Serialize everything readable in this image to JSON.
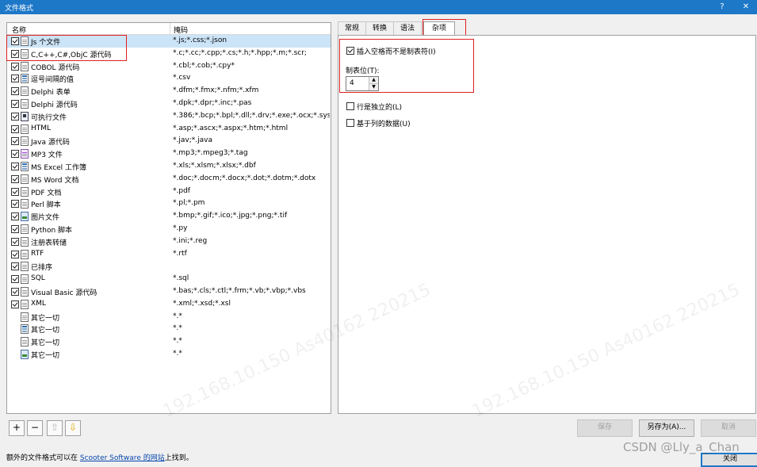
{
  "window": {
    "title": "文件格式",
    "help": "?",
    "close": "✕"
  },
  "list": {
    "col_name": "名称",
    "col_mask": "掩码",
    "rows": [
      {
        "name": "Js 个文件",
        "mask": "*.js;*.css;*.json",
        "icon": "file-icon",
        "checked": true,
        "selected": true
      },
      {
        "name": "C,C++,C#,ObjC 源代码",
        "mask": "*.c;*.cc;*.cpp;*.cs;*.h;*.hpp;*.m;*.scr;",
        "icon": "file-icon",
        "checked": true
      },
      {
        "name": "COBOL 源代码",
        "mask": "*.cbl;*.cob;*.cpy*",
        "icon": "file-icon",
        "checked": true
      },
      {
        "name": "逗号间隔的值",
        "mask": "*.csv",
        "icon": "grid-icon",
        "checked": true
      },
      {
        "name": "Delphi 表单",
        "mask": "*.dfm;*.fmx;*.nfm;*.xfm",
        "icon": "file-icon",
        "checked": true
      },
      {
        "name": "Delphi 源代码",
        "mask": "*.dpk;*.dpr;*.inc;*.pas",
        "icon": "file-icon",
        "checked": true
      },
      {
        "name": "可执行文件",
        "mask": "*.386;*.bcp;*.bpl;*.dll;*.drv;*.exe;*.ocx;*.sys;*...",
        "icon": "exec-icon",
        "checked": true
      },
      {
        "name": "HTML",
        "mask": "*.asp;*.ascx;*.aspx;*.htm;*.html",
        "icon": "file-icon",
        "checked": true
      },
      {
        "name": "Java 源代码",
        "mask": "*.jav;*.java",
        "icon": "file-icon",
        "checked": true
      },
      {
        "name": "MP3 文件",
        "mask": "*.mp3;*.mpeg3;*.tag",
        "icon": "music-icon",
        "checked": true
      },
      {
        "name": "MS Excel 工作簿",
        "mask": "*.xls;*.xlsm;*.xlsx;*.dbf",
        "icon": "grid-icon",
        "checked": true
      },
      {
        "name": "MS Word 文档",
        "mask": "*.doc;*.docm;*.docx;*.dot;*.dotm;*.dotx",
        "icon": "file-icon",
        "checked": true
      },
      {
        "name": "PDF 文档",
        "mask": "*.pdf",
        "icon": "file-icon",
        "checked": true
      },
      {
        "name": "Perl 脚本",
        "mask": "*.pl;*.pm",
        "icon": "file-icon",
        "checked": true
      },
      {
        "name": "图片文件",
        "mask": "*.bmp;*.gif;*.ico;*.jpg;*.png;*.tif",
        "icon": "image-icon",
        "checked": true
      },
      {
        "name": "Python 脚本",
        "mask": "*.py",
        "icon": "file-icon",
        "checked": true
      },
      {
        "name": "注册表转储",
        "mask": "*.ini;*.reg",
        "icon": "file-icon",
        "checked": true
      },
      {
        "name": "RTF",
        "mask": "*.rtf",
        "icon": "file-icon",
        "checked": true
      },
      {
        "name": "已排序",
        "mask": "",
        "icon": "file-icon",
        "checked": true
      },
      {
        "name": "SQL",
        "mask": "*.sql",
        "icon": "file-icon",
        "checked": true
      },
      {
        "name": "Visual Basic 源代码",
        "mask": "*.bas;*.cls;*.ctl;*.frm;*.vb;*.vbp;*.vbs",
        "icon": "file-icon",
        "checked": true
      },
      {
        "name": "XML",
        "mask": "*.xml;*.xsd;*.xsl",
        "icon": "file-icon",
        "checked": true
      },
      {
        "name": "其它一切",
        "mask": "*.*",
        "icon": "file-icon",
        "checked": false
      },
      {
        "name": "其它一切",
        "mask": "*.*",
        "icon": "grid-icon",
        "checked": false
      },
      {
        "name": "其它一切",
        "mask": "*.*",
        "icon": "file-icon",
        "checked": false
      },
      {
        "name": "其它一切",
        "mask": "*.*",
        "icon": "image-icon",
        "checked": false
      }
    ]
  },
  "tabs": [
    "常规",
    "转换",
    "语法",
    "杂项"
  ],
  "misc": {
    "insert_spaces": "插入空格而不是制表符(I)",
    "tab_stop_label": "制表位(T):",
    "tab_stop_value": "4",
    "line_independent": "行是独立的(L)",
    "column_based": "基于列的数据(U)"
  },
  "toolbar": {
    "add": "+",
    "remove": "−",
    "up": "⇧",
    "down": "⇩"
  },
  "buttons": {
    "save": "保存",
    "save_as": "另存为(A)...",
    "cancel": "取消",
    "close": "关闭"
  },
  "footer": {
    "prefix": "额外的文件格式可以在 ",
    "link": "Scooter Software 的网站",
    "suffix": "上找到。"
  },
  "watermarks": {
    "csdn": "CSDN @Lly_a_Chan",
    "ip": "192.168.10.150 As40162 220215"
  }
}
